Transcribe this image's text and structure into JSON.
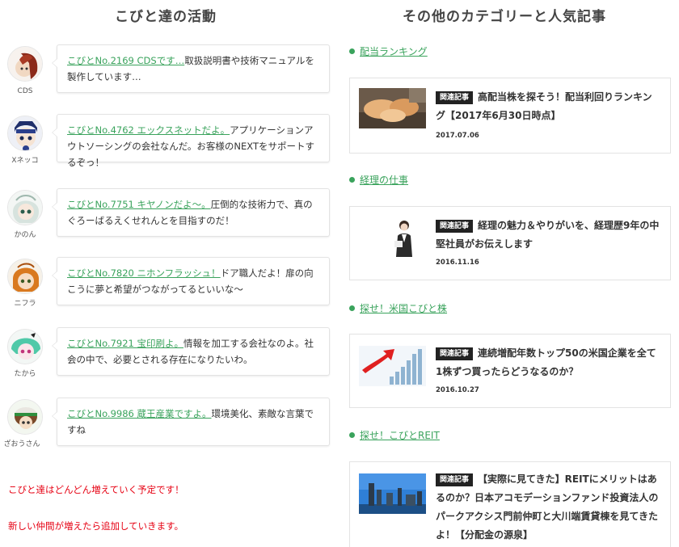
{
  "left": {
    "title": "こびと達の活動",
    "characters": [
      {
        "name": "CDS",
        "link": "こびとNo.2169 CDSです…",
        "text": "取扱説明書や技術マニュアルを製作しています…"
      },
      {
        "name": "Xネッコ",
        "link": "こびとNo.4762 エックスネットだよ。",
        "text": "アプリケーションアウトソーシングの会社なんだ。お客様のNEXTをサポートするぞっ！"
      },
      {
        "name": "かのん",
        "link": "こびとNo.7751 キヤノンだよ〜。",
        "text": "圧倒的な技術力で、真のぐろーばるえくせれんとを目指すのだ！"
      },
      {
        "name": "ニフラ",
        "link": "こびとNo.7820 ニホンフラッシュ！",
        "text": "ドア職人だよ！扉の向こうに夢と希望がつながってるといいな〜"
      },
      {
        "name": "たから",
        "link": "こびとNo.7921 宝印刷よ。",
        "text": "情報を加工する会社なのよ。社会の中で、必要とされる存在になりたいわ。"
      },
      {
        "name": "ざおうさん",
        "link": "こびとNo.9986 蔵王産業ですよ。",
        "text": "環境美化、素敵な言葉ですね"
      }
    ],
    "note1": "こびと達はどんどん増えていく予定です！",
    "note2": "新しい仲間が増えたら追加していきます。"
  },
  "right": {
    "title": "その他のカテゴリーと人気記事",
    "badge": "関連記事",
    "categories": [
      {
        "label": "配当ランキング",
        "title": "高配当株を探そう！配当利回りランキング【2017年6月30日時点】",
        "date": "2017.07.06",
        "thumb": "cats-photo"
      },
      {
        "label": "経理の仕事",
        "title": "経理の魅力＆やりがいを、経理歴9年の中堅社員がお伝えします",
        "date": "2016.11.16",
        "thumb": "businesswoman-photo"
      },
      {
        "label": "探せ！米国こびと株",
        "title": "連続増配年数トップ50の米国企業を全て1株ずつ買ったらどうなるのか？",
        "date": "2016.10.27",
        "thumb": "bar-chart-arrow-image"
      },
      {
        "label": "探せ！こびとREIT",
        "title": "【実際に見てきた】REITにメリットはあるのか？日本アコモデーションファンド投資法人のパークアクシス門前仲町と大川端賃貸棟を見てきたよ！【分配金の源泉】",
        "date": "",
        "thumb": "city-skyline-photo"
      }
    ]
  },
  "colors": {
    "link_green": "#3aa35c",
    "note_red": "#e60012",
    "badge_black": "#222222"
  }
}
